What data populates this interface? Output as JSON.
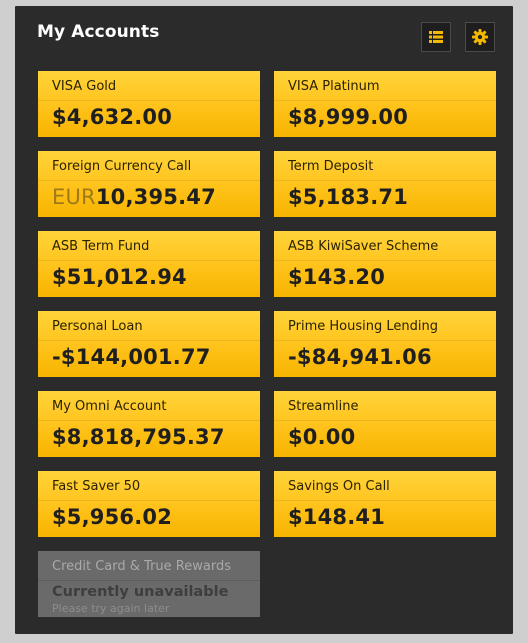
{
  "header": {
    "title": "My Accounts"
  },
  "toolbar": {
    "list_view_icon": "list-icon",
    "settings_icon": "gear-icon"
  },
  "colors": {
    "panel_background": "#2b2b2b",
    "tile_yellow": "#ffc21a",
    "tile_unavailable": "#6a6a6a",
    "toolbar_icon_accent": "#f5b800"
  },
  "accounts": [
    {
      "name": "VISA Gold",
      "balance": "$4,632.00"
    },
    {
      "name": "VISA Platinum",
      "balance": "$8,999.00"
    },
    {
      "name": "Foreign Currency Call",
      "currency": "EUR",
      "balance": "10,395.47"
    },
    {
      "name": "Term Deposit",
      "balance": "$5,183.71"
    },
    {
      "name": "ASB Term Fund",
      "balance": "$51,012.94"
    },
    {
      "name": "ASB KiwiSaver Scheme",
      "balance": "$143.20"
    },
    {
      "name": "Personal Loan",
      "balance": "-$144,001.77"
    },
    {
      "name": "Prime Housing Lending",
      "balance": "-$84,941.06"
    },
    {
      "name": "My Omni Account",
      "balance": "$8,818,795.37"
    },
    {
      "name": "Streamline",
      "balance": "$0.00"
    },
    {
      "name": "Fast Saver 50",
      "balance": "$5,956.02"
    },
    {
      "name": "Savings On Call",
      "balance": "$148.41"
    },
    {
      "name": "Credit Card & True Rewards",
      "status": "Currently unavailable",
      "hint": "Please try again later"
    }
  ]
}
